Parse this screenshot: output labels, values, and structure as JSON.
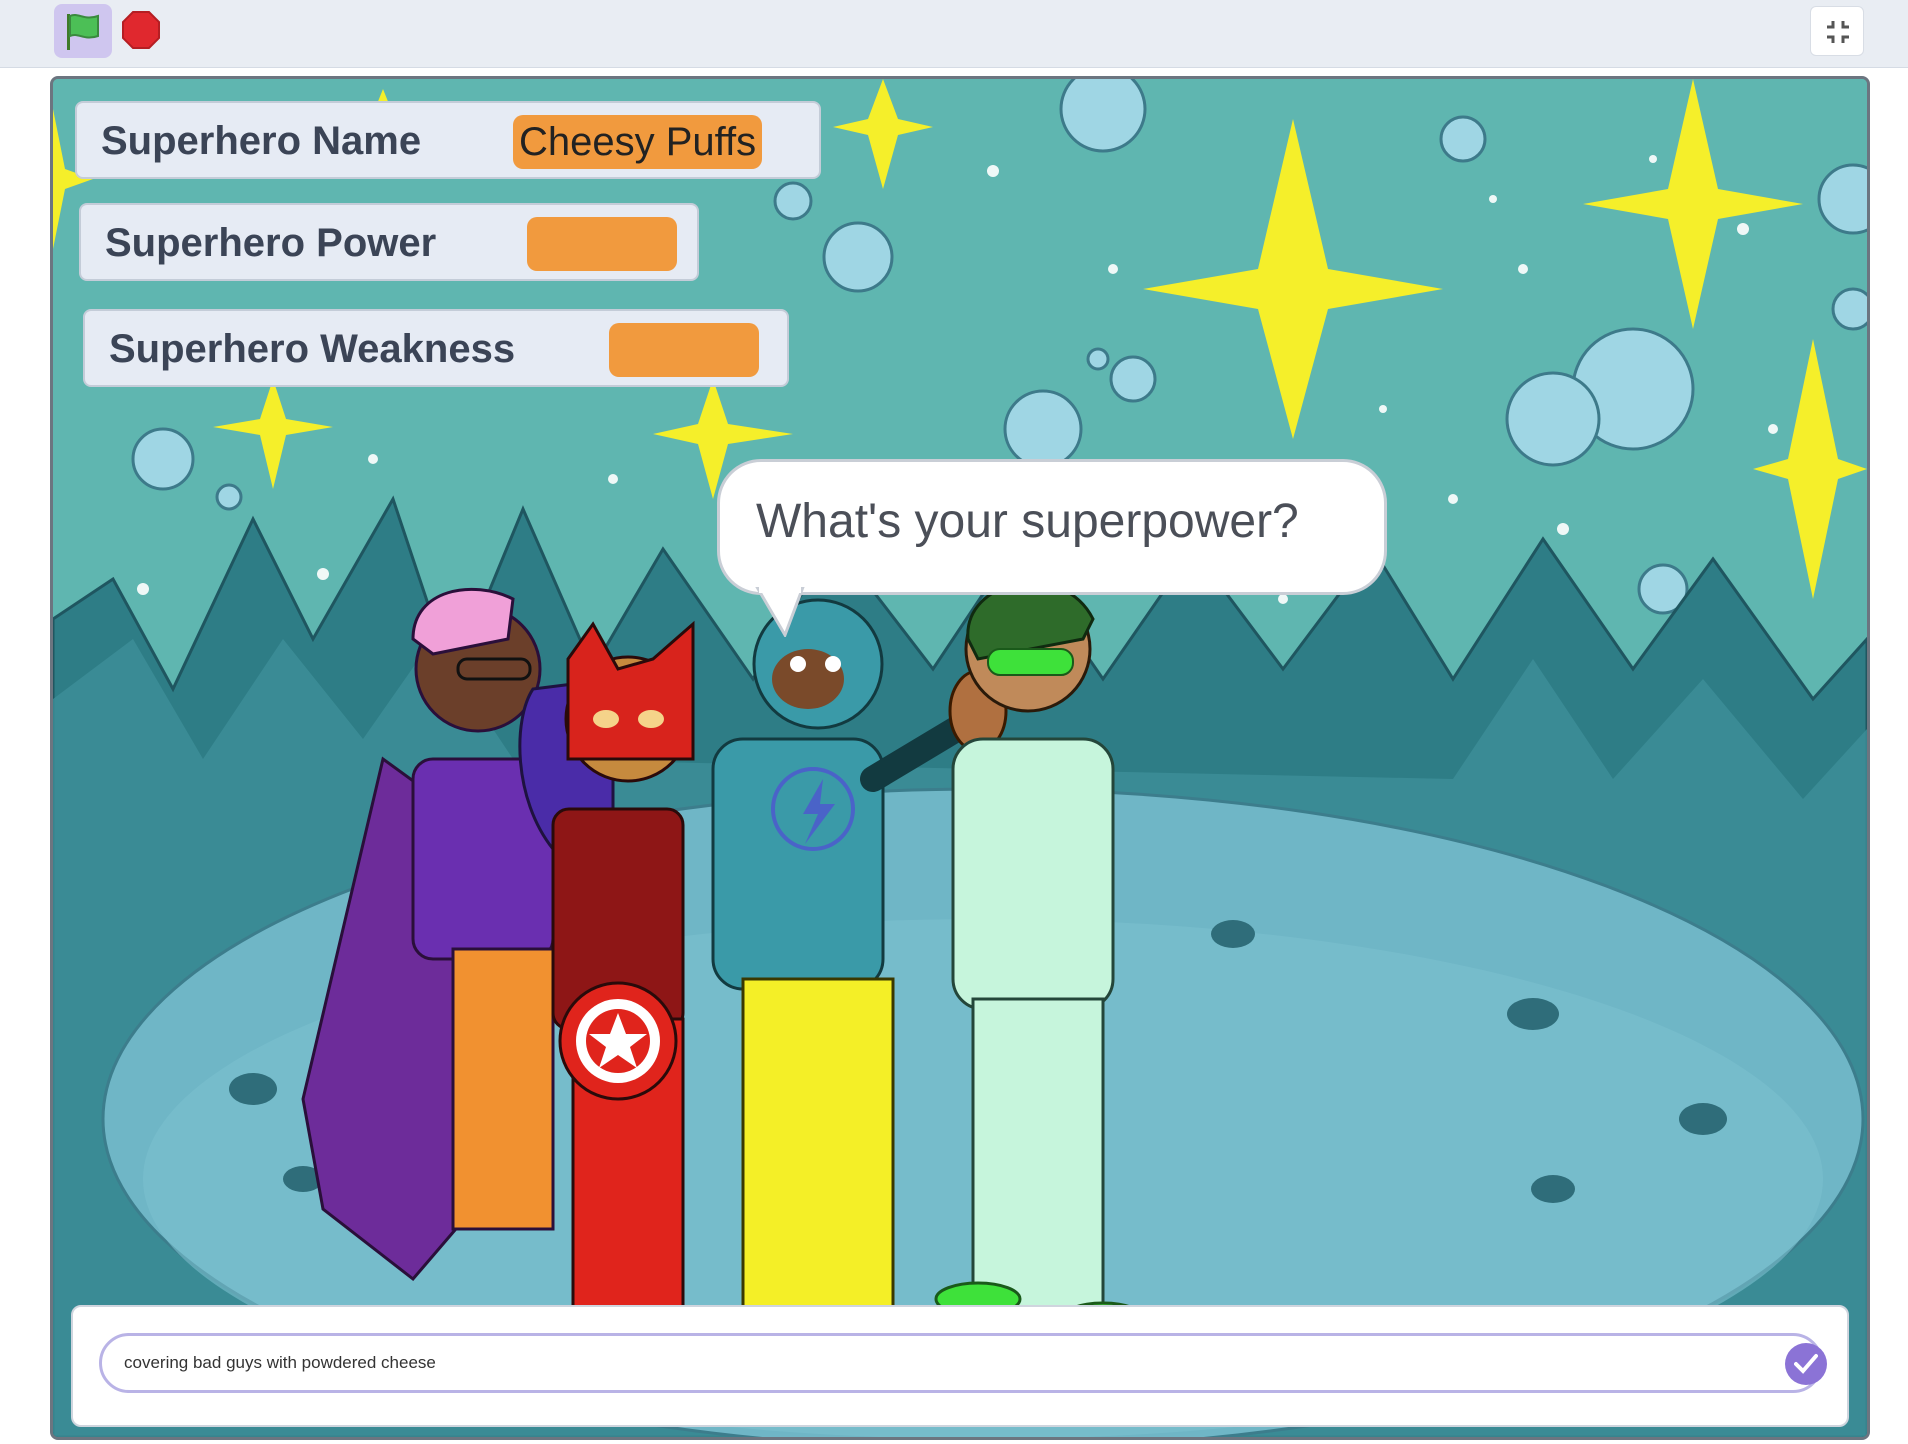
{
  "toolbar": {
    "green_flag_icon": "green-flag-icon",
    "stop_icon": "stop-icon",
    "fullscreen_icon": "exit-fullscreen-icon"
  },
  "monitors": [
    {
      "label": "Superhero Name",
      "value": "Cheesy Puffs"
    },
    {
      "label": "Superhero Power",
      "value": ""
    },
    {
      "label": "Superhero Weakness",
      "value": ""
    }
  ],
  "speech_bubble": {
    "text": "What's your superpower?"
  },
  "ask_prompt": {
    "answer": "covering bad guys with powdered cheese",
    "submit_icon": "check-icon"
  },
  "colors": {
    "monitor_value": "#f19a3e",
    "flag_button_bg": "#cfc6ef",
    "stop": "#e0282e",
    "submit": "#8b73d6",
    "sky": "#5fb6b0"
  }
}
